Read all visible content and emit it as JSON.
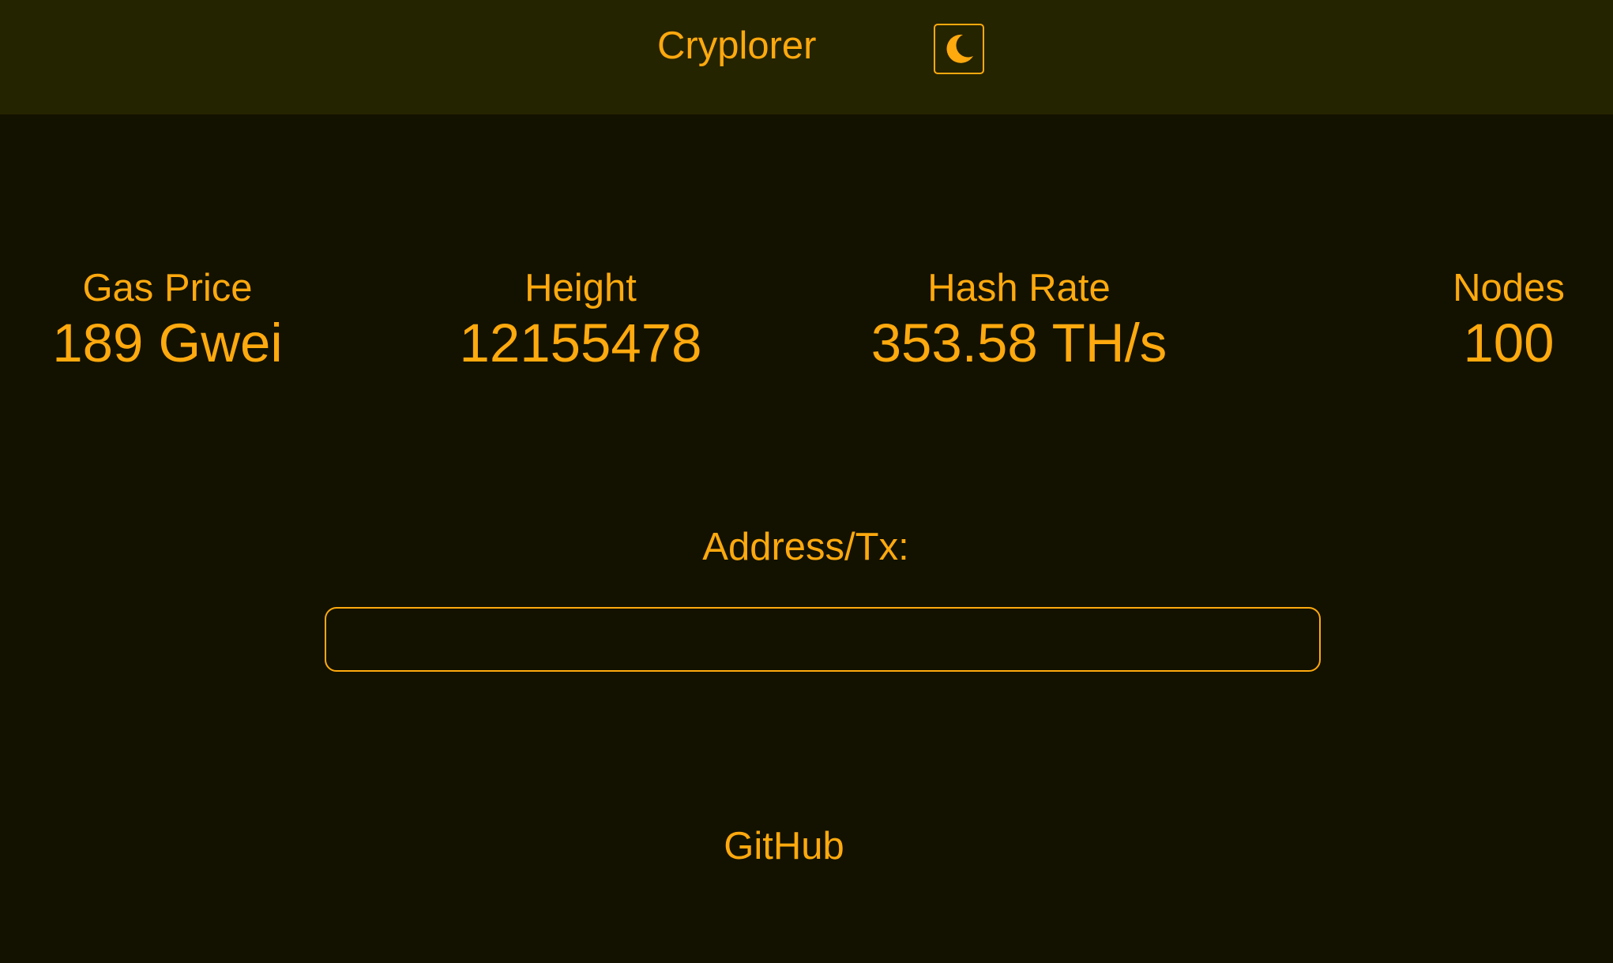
{
  "header": {
    "title": "Cryplorer",
    "theme_toggle_icon": "moon-icon"
  },
  "stats": {
    "gas_price": {
      "label": "Gas Price",
      "value": "189 Gwei"
    },
    "height": {
      "label": "Height",
      "value": "12155478"
    },
    "hash_rate": {
      "label": "Hash Rate",
      "value": "353.58 TH/s"
    },
    "nodes": {
      "label": "Nodes",
      "value": "100"
    }
  },
  "search": {
    "label": "Address/Tx:",
    "value": ""
  },
  "footer": {
    "github_label": "GitHub"
  },
  "colors": {
    "accent": "#fea90e",
    "header_bg": "#252400",
    "page_bg": "#131200"
  }
}
